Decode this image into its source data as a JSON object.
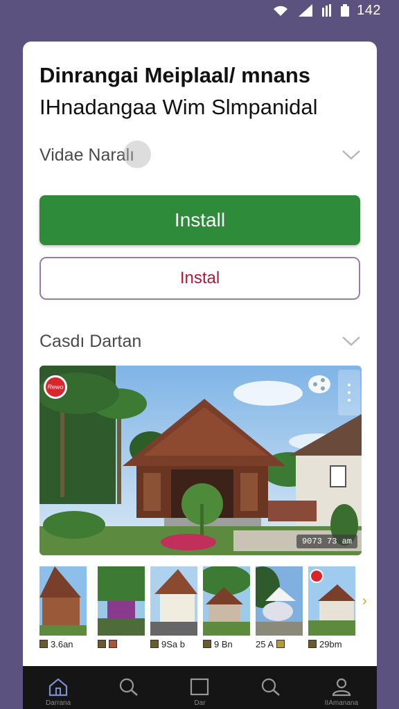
{
  "status_bar": {
    "time": "142"
  },
  "title": {
    "line1": "Dinrangai Meiplaal/ mnans",
    "line2": "IHnadangaa Wim Slmpanidal"
  },
  "sections": {
    "first": {
      "label": "Vidae Naralı"
    },
    "second": {
      "label": "Casdı Dartan"
    }
  },
  "buttons": {
    "install_primary": "Install",
    "install_secondary": "Instal"
  },
  "hero": {
    "badge": "Rewo",
    "caption": "9073 73 am"
  },
  "thumbnails": [
    {
      "label": "3.6an"
    },
    {
      "label": ""
    },
    {
      "label": "9Sa b"
    },
    {
      "label": "9 Bn"
    },
    {
      "label": "25 A"
    },
    {
      "label": "29bm"
    }
  ],
  "bottom_nav": [
    {
      "icon": "home-icon",
      "label": "Darrana"
    },
    {
      "icon": "search-icon",
      "label": ""
    },
    {
      "icon": "square-icon",
      "label": "Dar"
    },
    {
      "icon": "search-icon",
      "label": ""
    },
    {
      "icon": "profile-icon",
      "label": "IIAmanana"
    }
  ],
  "colors": {
    "background": "#5b527f",
    "install_green": "#2e8b3a",
    "secondary_text": "#b0173b"
  }
}
